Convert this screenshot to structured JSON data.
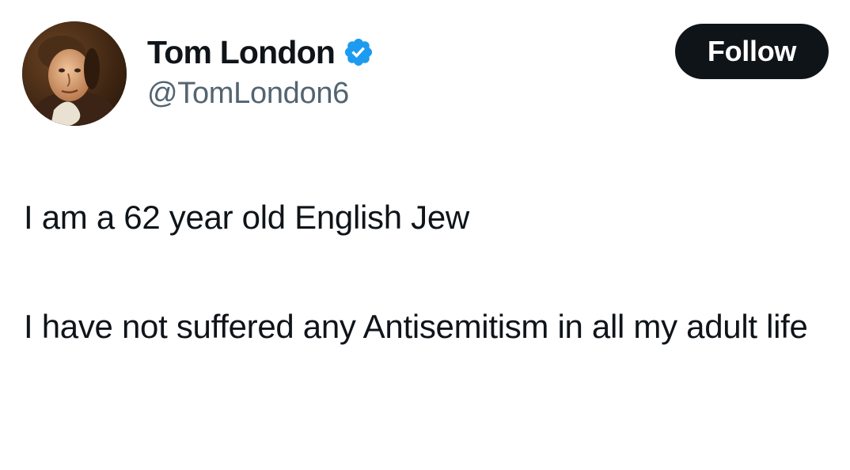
{
  "author": {
    "display_name": "Tom London",
    "handle": "@TomLondon6",
    "verified": true,
    "avatar_icon": "portrait-avatar-icon",
    "verified_icon": "verified-badge-icon",
    "verified_color": "#1d9bf0"
  },
  "follow_button": {
    "label": "Follow",
    "background": "#0f1419",
    "text_color": "#ffffff"
  },
  "tweet": {
    "line1": "I am a 62 year old English Jew",
    "line2": "I have not suffered any Antisemitism in all my adult life"
  }
}
